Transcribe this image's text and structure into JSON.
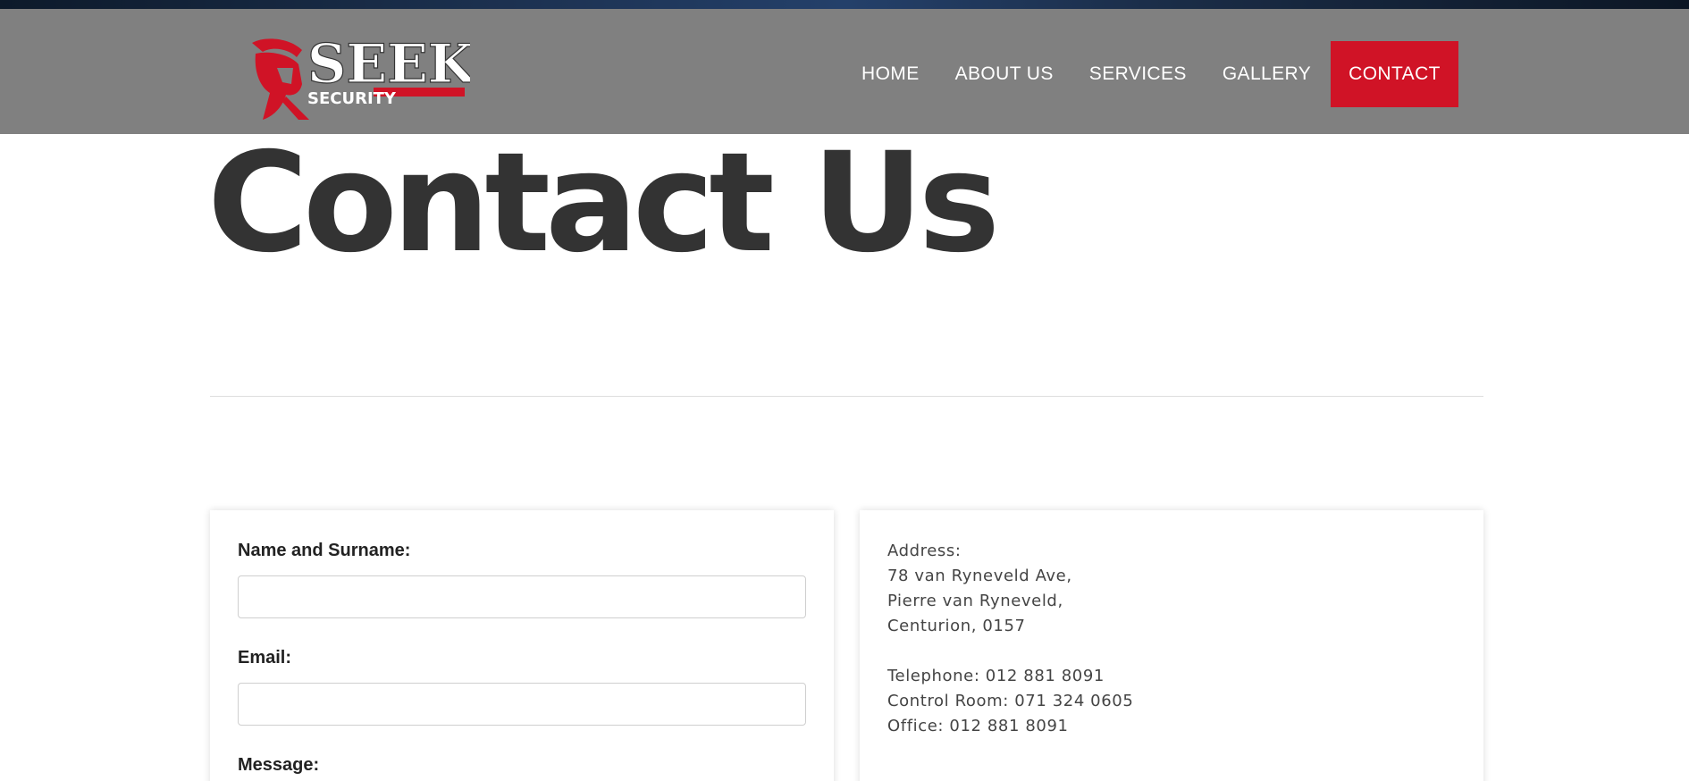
{
  "brand": {
    "name": "SEEK",
    "subtitle": "SECURITY",
    "colors": {
      "accent": "#d01326",
      "header_bg": "#808080",
      "text_dark": "#333333"
    }
  },
  "nav": {
    "items": [
      {
        "label": "HOME",
        "active": false
      },
      {
        "label": "ABOUT US",
        "active": false
      },
      {
        "label": "SERVICES",
        "active": false
      },
      {
        "label": "GALLERY",
        "active": false
      },
      {
        "label": "CONTACT",
        "active": true
      }
    ]
  },
  "page": {
    "title": "Contact Us"
  },
  "form": {
    "name_label": "Name and Surname:",
    "name_value": "",
    "email_label": "Email:",
    "email_value": "",
    "message_label": "Message:"
  },
  "contact_info": {
    "address_label": "Address:",
    "address_lines": [
      "78 van Ryneveld Ave,",
      "Pierre van Ryneveld,",
      "Centurion, 0157"
    ],
    "telephone": "Telephone: 012 881 8091",
    "control_room": "Control Room: 071 324 0605",
    "office": "Office: 012 881 8091"
  }
}
